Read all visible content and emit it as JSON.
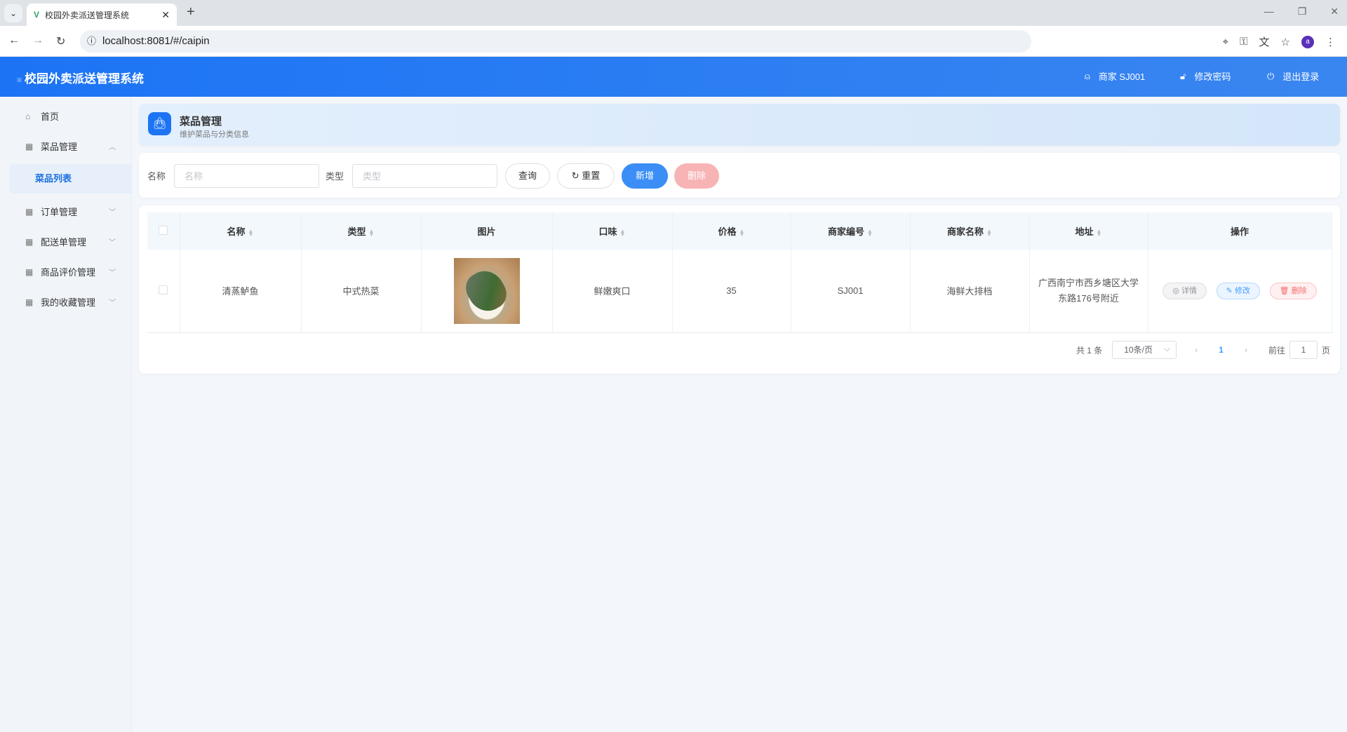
{
  "browser": {
    "tab_title": "校园外卖派送管理系统",
    "url": "localhost:8081/#/caipin",
    "avatar": "a"
  },
  "header": {
    "title": "校园外卖派送管理系统",
    "user": "商家 SJ001",
    "change_password": "修改密码",
    "logout": "退出登录"
  },
  "sidebar": {
    "items": [
      {
        "label": "首页"
      },
      {
        "label": "菜品管理",
        "sub": [
          {
            "label": "菜品列表"
          }
        ]
      },
      {
        "label": "订单管理"
      },
      {
        "label": "配送单管理"
      },
      {
        "label": "商品评价管理"
      },
      {
        "label": "我的收藏管理"
      }
    ]
  },
  "page": {
    "title": "菜品管理",
    "subtitle": "维护菜品与分类信息"
  },
  "search": {
    "name_label": "名称",
    "name_placeholder": "名称",
    "type_label": "类型",
    "type_placeholder": "类型",
    "query": "查询",
    "reset": "重置",
    "add": "新增",
    "delete": "删除"
  },
  "table": {
    "headers": [
      "名称",
      "类型",
      "图片",
      "口味",
      "价格",
      "商家编号",
      "商家名称",
      "地址",
      "操作"
    ],
    "rows": [
      {
        "name": "清蒸鲈鱼",
        "type": "中式热菜",
        "flavor": "鲜嫩爽口",
        "price": "35",
        "merchant_id": "SJ001",
        "merchant_name": "海鲜大排档",
        "address": "广西南宁市西乡塘区大学东路176号附近"
      }
    ],
    "actions": {
      "detail": "详情",
      "edit": "修改",
      "delete": "删除"
    }
  },
  "pagination": {
    "total": "共 1 条",
    "page_size": "10条/页",
    "current": "1",
    "goto_prefix": "前往",
    "goto_value": "1",
    "goto_suffix": "页"
  }
}
